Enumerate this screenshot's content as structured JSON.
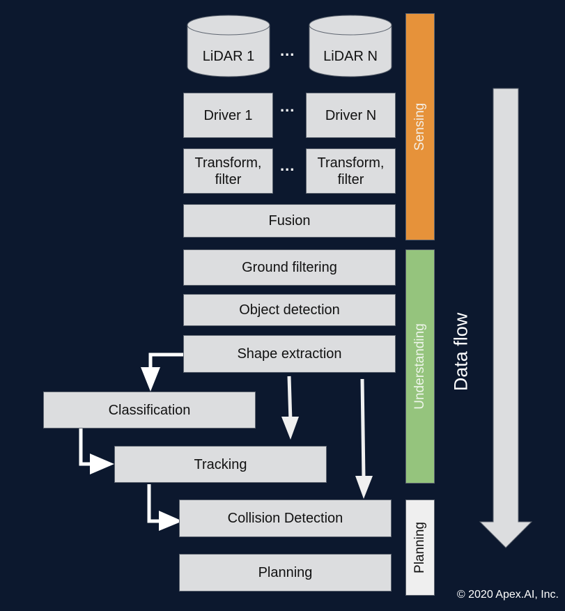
{
  "sensors": [
    {
      "label": "LiDAR 1"
    },
    {
      "label": "LiDAR N"
    }
  ],
  "ellipsis": "...",
  "drivers": [
    {
      "label": "Driver 1"
    },
    {
      "label": "Driver N"
    }
  ],
  "transforms": [
    {
      "line1": "Transform,",
      "line2": "filter"
    },
    {
      "line1": "Transform,",
      "line2": "filter"
    }
  ],
  "pipeline": {
    "fusion": "Fusion",
    "ground_filtering": "Ground filtering",
    "object_detection": "Object detection",
    "shape_extraction": "Shape extraction",
    "classification": "Classification",
    "tracking": "Tracking",
    "collision_detection": "Collision Detection",
    "planning": "Planning"
  },
  "phases": [
    {
      "label": "Sensing",
      "color": "#e6923a",
      "text_color": "#f4efe6"
    },
    {
      "label": "Understanding",
      "color": "#95c47d",
      "text_color": "#eef5ea"
    },
    {
      "label": "Planning",
      "color": "#efefef",
      "text_color": "#111111"
    }
  ],
  "flow_label": "Data flow",
  "copyright": "© 2020 Apex.AI, Inc.",
  "colors": {
    "background": "#0c182e",
    "box_fill": "#dcdddf",
    "arrow": "#ffffff",
    "flow_arrow": "#dcdddf"
  }
}
